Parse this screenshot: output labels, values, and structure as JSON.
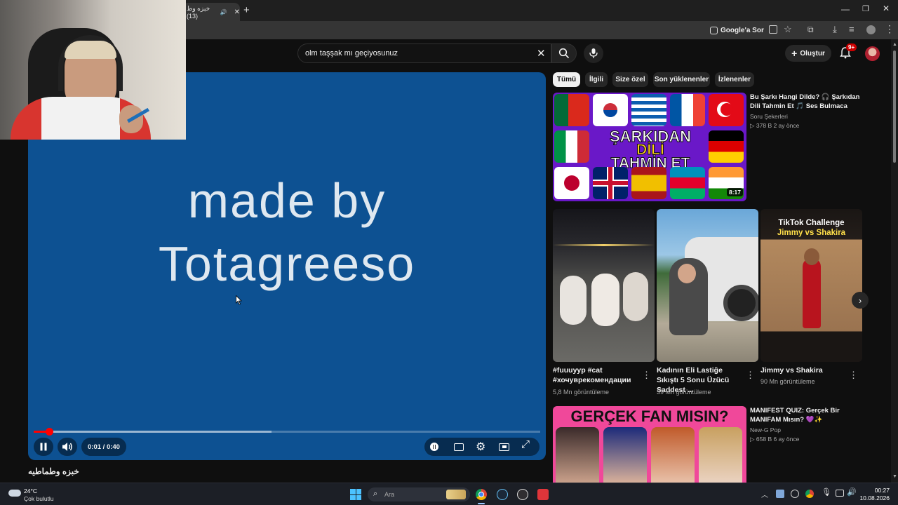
{
  "browser": {
    "tab_title": "خبزه وط (13)",
    "google_ask_label": "Google'a Sor"
  },
  "search": {
    "query": "olm taşşak mı geçiyosunuz"
  },
  "header": {
    "create_label": "Oluştur",
    "notification_badge": "9+"
  },
  "player": {
    "overlay_line1": "made by",
    "overlay_line2": "Totagreeso",
    "time": "0:01 / 0:40",
    "progress": 0.03,
    "buffered": 0.47
  },
  "video": {
    "title": "خبزه وطماطيه"
  },
  "chips": [
    "Tümü",
    "İlgili",
    "Size özel",
    "Son yüklenenler",
    "İzlenenler"
  ],
  "recommended": [
    {
      "title": "Bu Şarkı Hangi Dilde? 🎧 Şarkıdan Dili Tahmin Et 🎵 Ses Bulmaca",
      "channel": "Soru Şekerleri",
      "meta": "▷ 378 B   2 ay önce",
      "duration": "8:17",
      "thumb_text1": "ŞARKIDAN",
      "thumb_text2": "DİLİ",
      "thumb_text3": "TAHMİN ET"
    },
    {
      "title": "MANIFEST QUIZ: Gerçek Bir MANIFAM Mısın? 💜✨",
      "channel": "New-G Pop",
      "meta": "▷ 658 B   6 ay önce",
      "thumb_text": "GERÇEK FAN MISIN?"
    }
  ],
  "shorts": [
    {
      "title": "#fuuuyyp #cat #хочуврекомендации",
      "views": "5,8 Mn görüntüleme"
    },
    {
      "title": "Kadının Eli Lastiğe Sıkıştı 5 Sonu Üzücü Saddest ...",
      "views": "39 Mn görüntüleme"
    },
    {
      "title": "Jimmy vs Shakira",
      "views": "90 Mn görüntüleme",
      "thumb_line1": "TikTok Challenge",
      "thumb_line2": "Jimmy vs Shakira"
    }
  ],
  "taskbar": {
    "temperature": "24°C",
    "weather": "Çok bulutlu",
    "search_placeholder": "Ara",
    "time": "00:27",
    "date": "10.08.2026"
  },
  "colors": {
    "player_bg": "#0d5192",
    "progress_red": "#ff0000",
    "thumb_purple": "#7a1fd6",
    "thumb_pink": "#f0489a"
  }
}
